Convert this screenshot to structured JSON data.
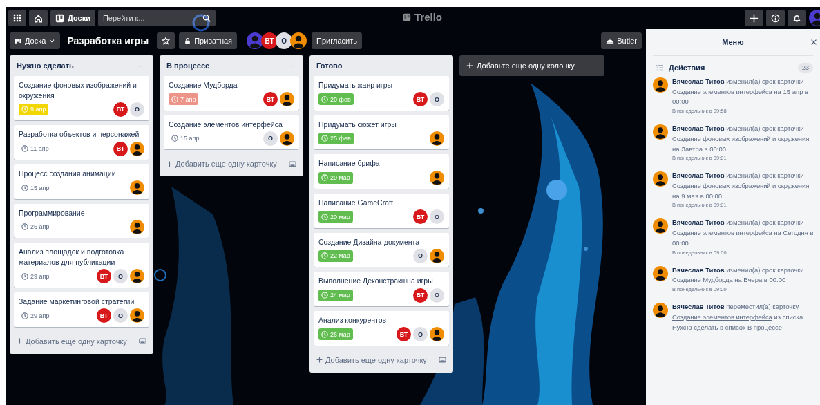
{
  "topbar": {
    "boards_label": "Доски",
    "search_placeholder": "Перейти к...",
    "logo": "Trello",
    "user": {
      "kind": "person",
      "color": "#4c3bcf"
    }
  },
  "board": {
    "menu_label": "Доска",
    "title": "Разработка игры",
    "visibility": "Приватная",
    "invite": "Пригласить",
    "butler": "Butler",
    "members": [
      {
        "kind": "person",
        "color": "#4c3bcf"
      },
      {
        "kind": "initials",
        "text": "ВТ",
        "color": "#d7191c"
      },
      {
        "kind": "initials",
        "text": "О",
        "color": "#dfe1e6"
      },
      {
        "kind": "person",
        "color": "#f08c00"
      }
    ]
  },
  "lists": [
    {
      "title": "Нужно сделать",
      "more": "···",
      "add_card": "Добавить еще одну карточку",
      "cards": [
        {
          "title": "Создание фоновых изображений и окружения",
          "due": {
            "text": "9 апр",
            "kind": "soon"
          },
          "members": [
            {
              "kind": "initials",
              "text": "ВТ",
              "color": "#d7191c"
            },
            {
              "kind": "initials",
              "text": "О",
              "color": "#dfe1e6"
            }
          ]
        },
        {
          "title": "Разработка объектов и персонажей",
          "due": {
            "text": "11 апр",
            "kind": "plain"
          },
          "members": [
            {
              "kind": "initials",
              "text": "ВТ",
              "color": "#d7191c"
            },
            {
              "kind": "person",
              "color": "#f08c00"
            }
          ]
        },
        {
          "title": "Процесс создания анимации",
          "due": {
            "text": "15 апр",
            "kind": "plain"
          },
          "members": [
            {
              "kind": "person",
              "color": "#f08c00"
            }
          ]
        },
        {
          "title": "Программирование",
          "due": {
            "text": "26 апр",
            "kind": "plain"
          },
          "members": [
            {
              "kind": "person",
              "color": "#f08c00"
            }
          ]
        },
        {
          "title": "Анализ площадок и подготовка материалов для публикации",
          "due": {
            "text": "29 апр",
            "kind": "plain"
          },
          "members": [
            {
              "kind": "initials",
              "text": "ВТ",
              "color": "#d7191c"
            },
            {
              "kind": "initials",
              "text": "О",
              "color": "#dfe1e6"
            },
            {
              "kind": "person",
              "color": "#f08c00"
            }
          ]
        },
        {
          "title": "Задание маркетинговой стратегии",
          "due": {
            "text": "29 апр",
            "kind": "plain"
          },
          "members": [
            {
              "kind": "initials",
              "text": "ВТ",
              "color": "#d7191c"
            },
            {
              "kind": "initials",
              "text": "О",
              "color": "#dfe1e6"
            },
            {
              "kind": "person",
              "color": "#f08c00"
            }
          ]
        }
      ]
    },
    {
      "title": "В процессе",
      "more": "···",
      "add_card": "Добавить еще одну карточку",
      "cards": [
        {
          "title": "Создание Мудборда",
          "due": {
            "text": "7 апр",
            "kind": "overdue"
          },
          "members": [
            {
              "kind": "initials",
              "text": "ВТ",
              "color": "#d7191c"
            },
            {
              "kind": "person",
              "color": "#f08c00"
            }
          ]
        },
        {
          "title": "Создание элементов интерфейса",
          "due": {
            "text": "15 апр",
            "kind": "plain"
          },
          "members": [
            {
              "kind": "initials",
              "text": "О",
              "color": "#dfe1e6"
            },
            {
              "kind": "person",
              "color": "#f08c00"
            }
          ]
        }
      ]
    },
    {
      "title": "Готово",
      "more": "···",
      "add_card": "Добавить еще одну карточку",
      "cards": [
        {
          "title": "Придумать жанр игры",
          "due": {
            "text": "20 фев",
            "kind": "complete"
          },
          "members": [
            {
              "kind": "initials",
              "text": "ВТ",
              "color": "#d7191c"
            },
            {
              "kind": "initials",
              "text": "О",
              "color": "#dfe1e6"
            }
          ]
        },
        {
          "title": "Придумать сюжет игры",
          "due": {
            "text": "25 фев",
            "kind": "complete"
          },
          "members": [
            {
              "kind": "person",
              "color": "#f08c00"
            }
          ]
        },
        {
          "title": "Написание брифа",
          "due": {
            "text": "20 мар",
            "kind": "complete"
          },
          "members": [
            {
              "kind": "person",
              "color": "#f08c00"
            }
          ]
        },
        {
          "title": "Написание GameCraft",
          "due": {
            "text": "20 мар",
            "kind": "complete"
          },
          "members": [
            {
              "kind": "initials",
              "text": "ВТ",
              "color": "#d7191c"
            },
            {
              "kind": "initials",
              "text": "О",
              "color": "#dfe1e6"
            }
          ]
        },
        {
          "title": "Создание Дизайна-документа",
          "due": {
            "text": "22 мар",
            "kind": "complete"
          },
          "members": [
            {
              "kind": "initials",
              "text": "О",
              "color": "#dfe1e6"
            },
            {
              "kind": "person",
              "color": "#f08c00"
            }
          ]
        },
        {
          "title": "Выполнение Деконстракшна игры",
          "due": {
            "text": "24 мар",
            "kind": "complete"
          },
          "members": [
            {
              "kind": "initials",
              "text": "ВТ",
              "color": "#d7191c"
            },
            {
              "kind": "initials",
              "text": "О",
              "color": "#dfe1e6"
            }
          ]
        },
        {
          "title": "Анализ конкурентов",
          "due": {
            "text": "26 мар",
            "kind": "complete"
          },
          "members": [
            {
              "kind": "initials",
              "text": "ВТ",
              "color": "#d7191c"
            },
            {
              "kind": "initials",
              "text": "О",
              "color": "#dfe1e6"
            },
            {
              "kind": "person",
              "color": "#f08c00"
            }
          ]
        }
      ]
    }
  ],
  "add_column": "Добавьте еще одну колонку",
  "menu": {
    "title": "Меню",
    "section": "Действия",
    "count": "23",
    "activities": [
      {
        "user": "Вячеслав Титов",
        "verb": "изменил(а) срок карточки",
        "link": "Создание элементов интерфейса",
        "rest": "на 15 апр в 00:00",
        "time": "В понедельник в 09:58",
        "avatar": {
          "kind": "person",
          "color": "#f08c00"
        }
      },
      {
        "user": "Вячеслав Титов",
        "verb": "изменил(а) срок карточки",
        "link": "Создание фоновых изображений и окружения",
        "rest": "на Завтра в 00:00",
        "time": "В понедельник в 09:01",
        "avatar": {
          "kind": "person",
          "color": "#f08c00"
        }
      },
      {
        "user": "Вячеслав Титов",
        "verb": "изменил(а) срок карточки",
        "link": "Создание фоновых изображений и окружения",
        "rest": "на 9 мая в 00:00",
        "time": "В понедельник в 09:01",
        "avatar": {
          "kind": "person",
          "color": "#f08c00"
        }
      },
      {
        "user": "Вячеслав Титов",
        "verb": "изменил(а) срок карточки",
        "link": "Создание элементов интерфейса",
        "rest": "на Сегодня в 00:00",
        "time": "В понедельник в 09:00",
        "avatar": {
          "kind": "person",
          "color": "#f08c00"
        }
      },
      {
        "user": "Вячеслав Титов",
        "verb": "изменил(а) срок карточки",
        "link": "Создание Мудборда",
        "rest": "на Вчера в 00:00",
        "time": "В понедельник в 09:00",
        "avatar": {
          "kind": "person",
          "color": "#f08c00"
        }
      },
      {
        "user": "Вячеслав Титов",
        "verb": "переместил(а) карточку",
        "link": "Создание элементов интерфейса",
        "rest": "из списка Нужно сделать в список В процессе",
        "avatar": {
          "kind": "person",
          "color": "#f08c00"
        }
      }
    ]
  }
}
